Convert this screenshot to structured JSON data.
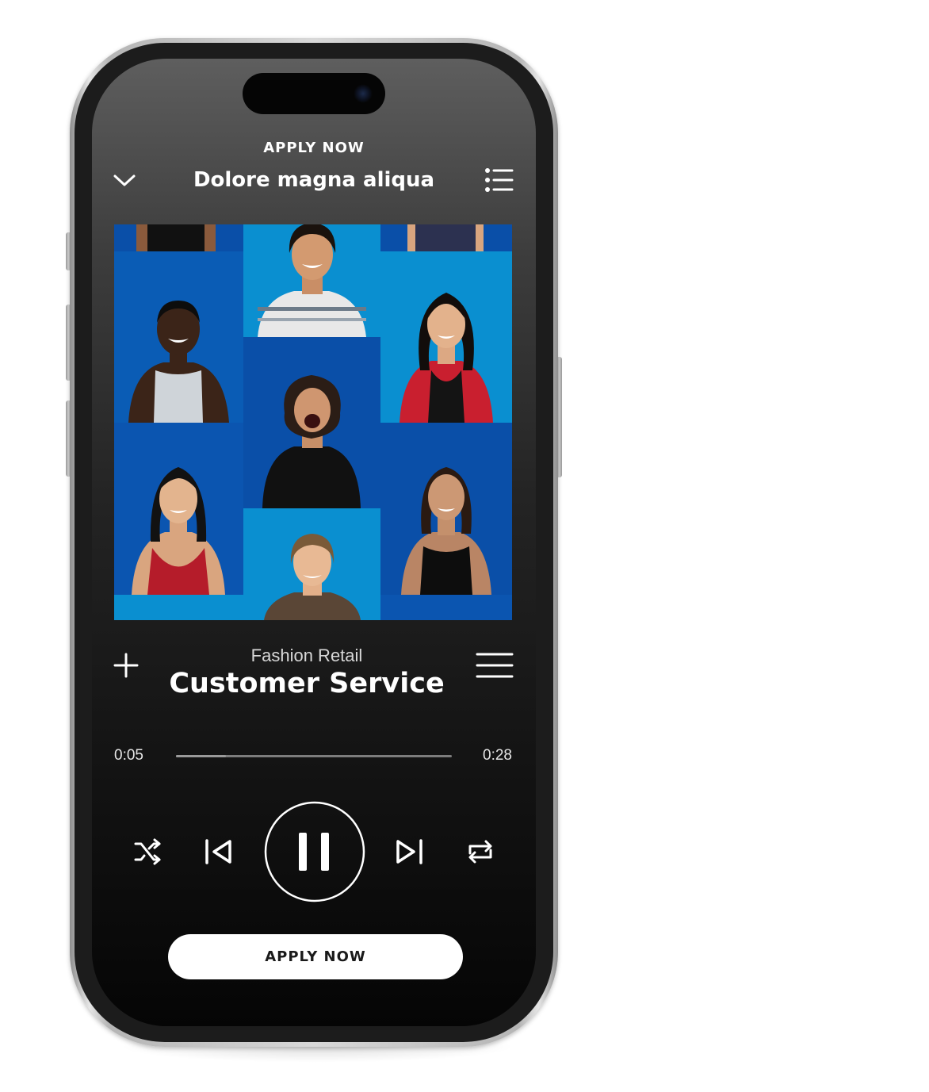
{
  "header": {
    "caption": "APPLY NOW",
    "title": "Dolore magna aliqua"
  },
  "icons": {
    "collapse": "chevron-down-icon",
    "queue": "queue-list-icon",
    "add": "plus-icon",
    "menu": "hamburger-menu-icon",
    "shuffle": "shuffle-icon",
    "previous": "skip-previous-icon",
    "play_state": "pause-icon",
    "next": "skip-next-icon",
    "repeat": "repeat-icon"
  },
  "track": {
    "subtitle": "Fashion Retail",
    "title": "Customer Service"
  },
  "playback": {
    "elapsed": "0:05",
    "total": "0:28",
    "progress_fraction": 0.18
  },
  "cta": {
    "label": "APPLY NOW"
  },
  "colors": {
    "screen_top": "#5e5e5e",
    "screen_bottom": "#050505",
    "artwork_blue": "#0a4fa8",
    "artwork_cyan": "#0a8fd0",
    "text_primary": "#ffffff",
    "cta_background": "#ffffff",
    "cta_text": "#1a1a1a"
  }
}
